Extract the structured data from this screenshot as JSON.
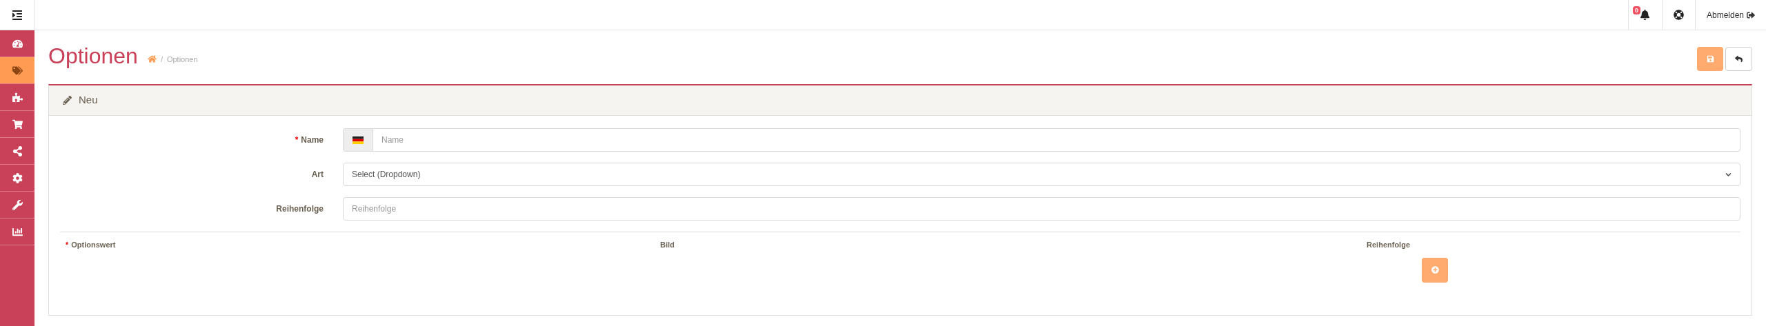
{
  "topbar": {
    "notification_count": "0",
    "logout": "Abmelden"
  },
  "sidebar": {
    "items": [
      {
        "kind": "dashboard",
        "selected": false
      },
      {
        "kind": "tags",
        "selected": true
      },
      {
        "kind": "puzzle",
        "selected": false
      },
      {
        "kind": "cart",
        "selected": false
      },
      {
        "kind": "share",
        "selected": false
      },
      {
        "kind": "gear",
        "selected": false
      },
      {
        "kind": "wrench",
        "selected": false
      },
      {
        "kind": "chart",
        "selected": false
      }
    ]
  },
  "page": {
    "title": "Optionen",
    "breadcrumb_separator": "/",
    "breadcrumb": [
      "Optionen"
    ]
  },
  "card": {
    "title": "Neu",
    "fields": [
      {
        "kind": "lang-text",
        "label": "Name",
        "required_mark": "*",
        "placeholder": "Name"
      },
      {
        "kind": "select",
        "label": "Art",
        "value": "Select (Dropdown)"
      },
      {
        "kind": "text",
        "label": "Reihenfolge",
        "placeholder": "Reihenfolge"
      }
    ],
    "values_table": {
      "columns": [
        {
          "label": "Optionswert",
          "required_mark": "*"
        },
        {
          "label": "Bild"
        },
        {
          "label": "Reihenfolge"
        }
      ]
    }
  }
}
